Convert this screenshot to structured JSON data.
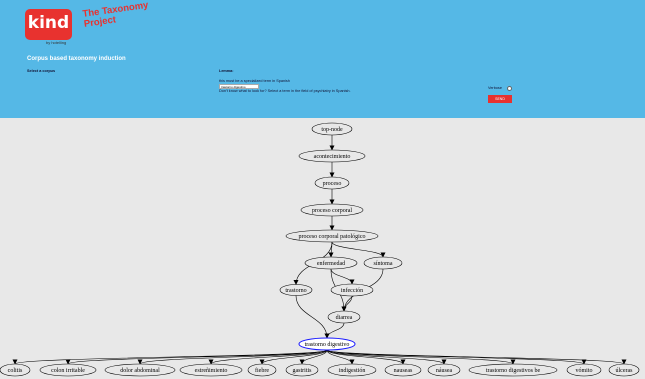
{
  "brand": {
    "logo_text": "kind",
    "logo_sub": "by hotelling",
    "project_title": "The Taxonomy Project"
  },
  "page": {
    "title": "Corpus based taxonomy induction"
  },
  "form": {
    "corpus_label": "Select a corpus",
    "lemma_label": "Lemma:",
    "lemma_hint": "this must be a specialized term in Spanish",
    "lemma_value": "trastorno digestivo",
    "lemma_help": "Don't know what to look for? Select a term in the field of psychiatry in Spanish.",
    "verbose_label": "Verbose",
    "send_label": "SEND"
  },
  "graph": {
    "nodes": [
      {
        "id": "top",
        "label": "top-node"
      },
      {
        "id": "acont",
        "label": "acontecimiento"
      },
      {
        "id": "proc",
        "label": "proceso"
      },
      {
        "id": "pcorp",
        "label": "proceso corporal"
      },
      {
        "id": "ppat",
        "label": "proceso corporal patológico"
      },
      {
        "id": "enf",
        "label": "enfermedad"
      },
      {
        "id": "sint",
        "label": "síntoma"
      },
      {
        "id": "trast",
        "label": "trastorno"
      },
      {
        "id": "infec",
        "label": "infección"
      },
      {
        "id": "diar",
        "label": "diarrea"
      },
      {
        "id": "tdig",
        "label": "trastorno digestivo"
      },
      {
        "id": "l1",
        "label": "colitis"
      },
      {
        "id": "l2",
        "label": "colon irritable"
      },
      {
        "id": "l3",
        "label": "dolor abdominal"
      },
      {
        "id": "l4",
        "label": "estreñimiento"
      },
      {
        "id": "l5",
        "label": "fiebre"
      },
      {
        "id": "l6",
        "label": "gastritis"
      },
      {
        "id": "l7",
        "label": "indigestión"
      },
      {
        "id": "l8",
        "label": "nauseas"
      },
      {
        "id": "l9",
        "label": "náusea"
      },
      {
        "id": "l10",
        "label": "trastorno digestivos be"
      },
      {
        "id": "l11",
        "label": "vómito"
      },
      {
        "id": "l12",
        "label": "úlceras"
      }
    ],
    "edges": [
      [
        "top",
        "acont"
      ],
      [
        "acont",
        "proc"
      ],
      [
        "proc",
        "pcorp"
      ],
      [
        "pcorp",
        "ppat"
      ],
      [
        "ppat",
        "enf"
      ],
      [
        "ppat",
        "sint"
      ],
      [
        "ppat",
        "trast"
      ],
      [
        "enf",
        "infec"
      ],
      [
        "enf",
        "diar"
      ],
      [
        "sint",
        "diar"
      ],
      [
        "infec",
        "diar"
      ],
      [
        "trast",
        "tdig"
      ],
      [
        "diar",
        "tdig"
      ],
      [
        "tdig",
        "l1"
      ],
      [
        "tdig",
        "l2"
      ],
      [
        "tdig",
        "l3"
      ],
      [
        "tdig",
        "l4"
      ],
      [
        "tdig",
        "l5"
      ],
      [
        "tdig",
        "l6"
      ],
      [
        "tdig",
        "l7"
      ],
      [
        "tdig",
        "l8"
      ],
      [
        "tdig",
        "l9"
      ],
      [
        "tdig",
        "l10"
      ],
      [
        "tdig",
        "l11"
      ],
      [
        "tdig",
        "l12"
      ]
    ],
    "highlight": "tdig",
    "highlight_color": "#1a1aff"
  }
}
